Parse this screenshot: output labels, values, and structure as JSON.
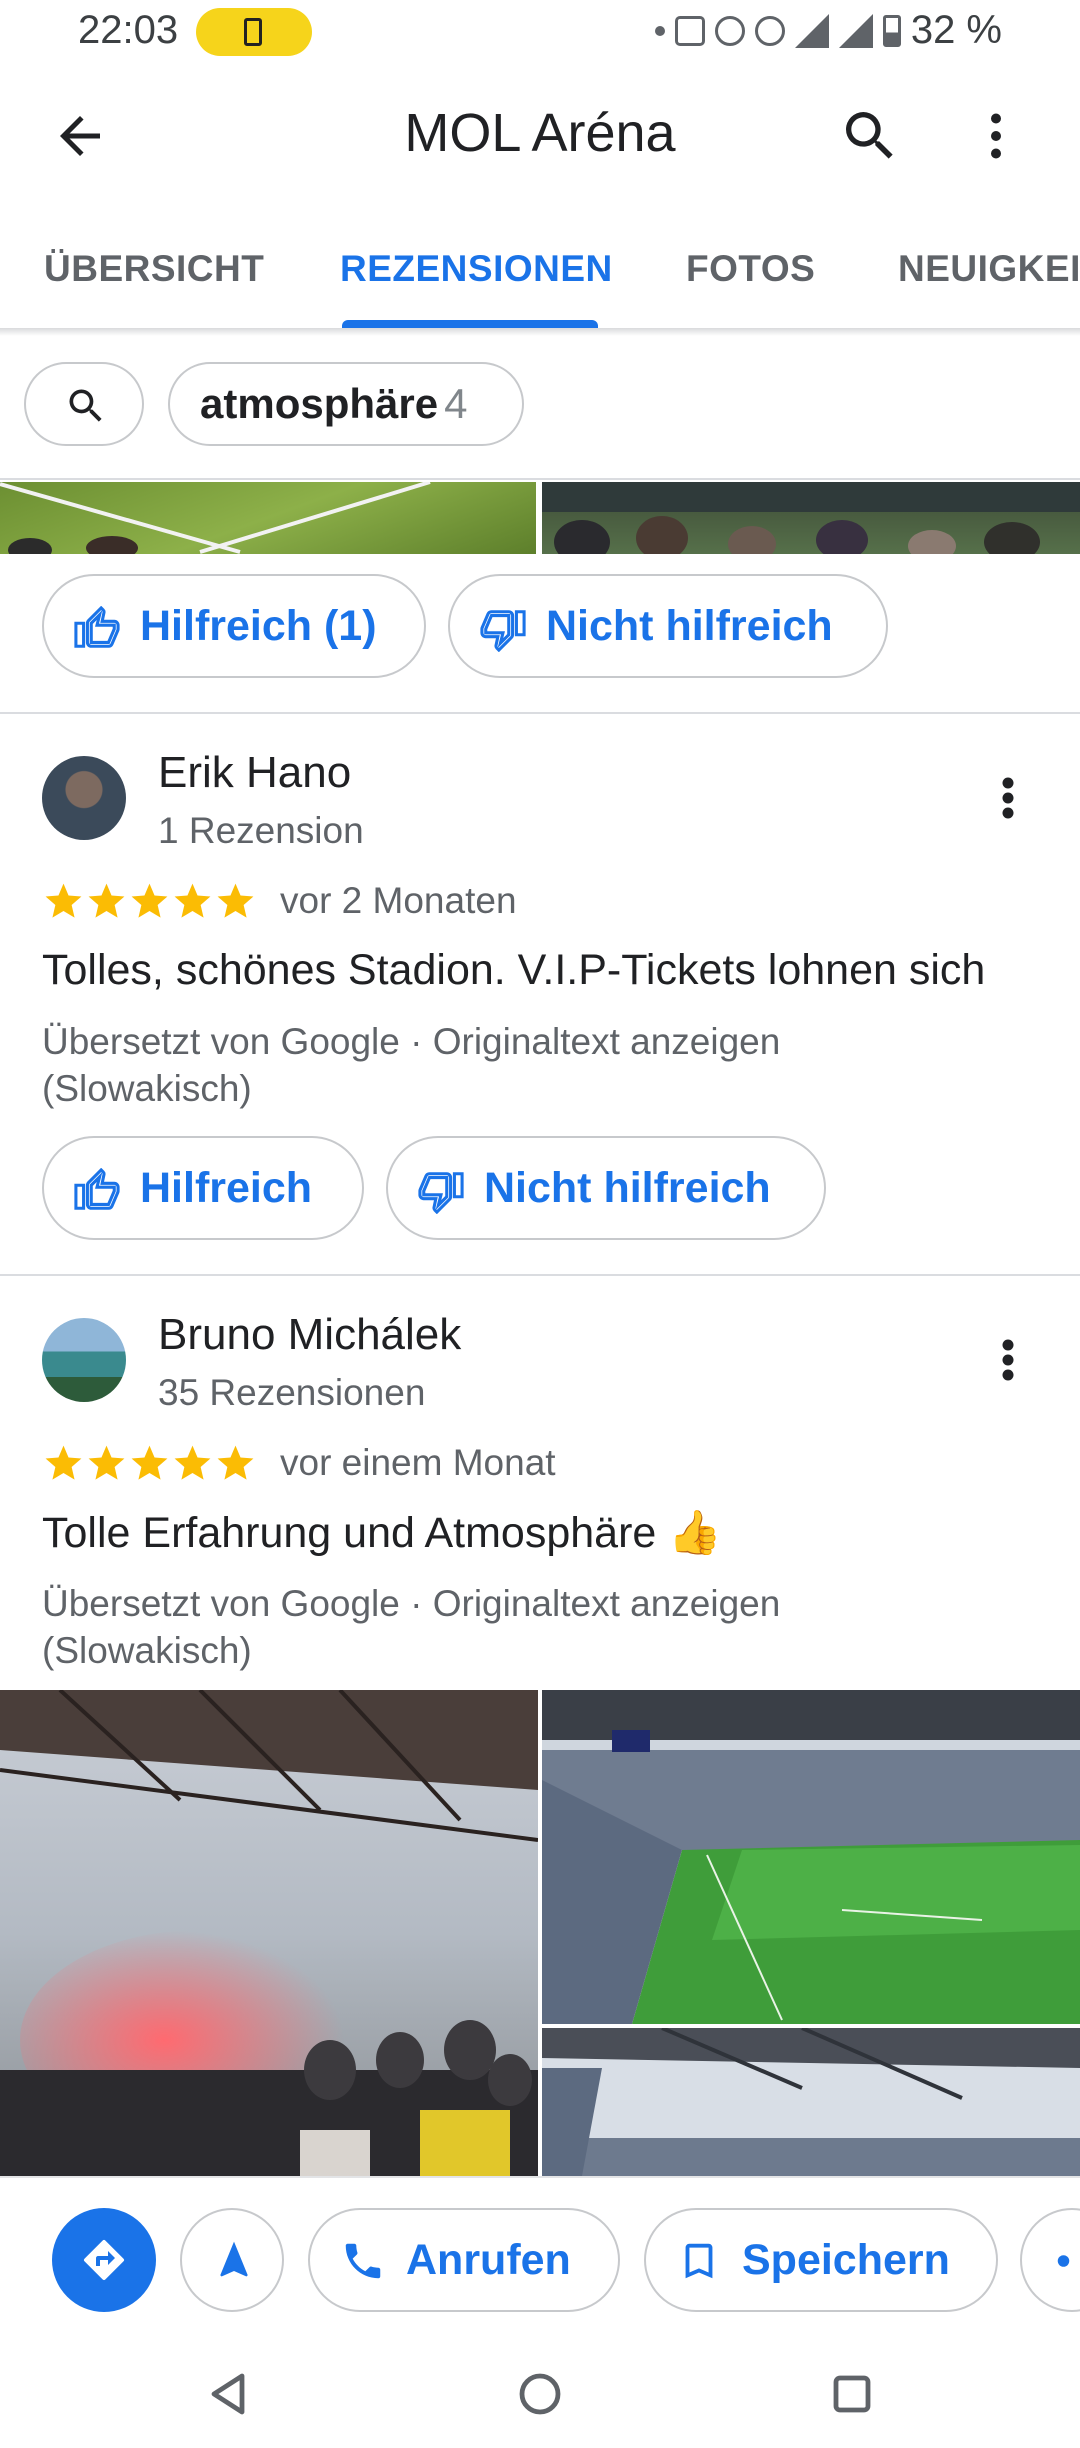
{
  "status_bar": {
    "time": "22:03",
    "battery_percent": "32 %",
    "icons": [
      "dot-icon",
      "60hz-icon",
      "location-icon",
      "wifi-icon",
      "signal-icon",
      "battery-icon"
    ]
  },
  "app_bar": {
    "title": "MOL Aréna",
    "icons": [
      "back-arrow-icon",
      "search-icon",
      "more-vert-icon"
    ]
  },
  "tabs": [
    {
      "label": "ÜBERSICHT",
      "active": false
    },
    {
      "label": "REZENSIONEN",
      "active": true
    },
    {
      "label": "FOTOS",
      "active": false
    },
    {
      "label": "NEUIGKEITEN",
      "active": false
    }
  ],
  "filter": {
    "keyword": "atmosphäre",
    "count": "4"
  },
  "previous_review": {
    "helpful_label": "Hilfreich (1)",
    "not_helpful_label": "Nicht hilfreich"
  },
  "reviews": [
    {
      "name": "Erik Hano",
      "meta": "1 Rezension",
      "rating": 5,
      "date": "vor 2 Monaten",
      "text": "Tolles, schönes Stadion. V.I.P-Tickets lohnen sich",
      "translated_by": "Übersetzt von Google · Originaltext anzeigen",
      "original_language": "(Slowakisch)",
      "helpful_label": "Hilfreich",
      "not_helpful_label": "Nicht hilfreich"
    },
    {
      "name": "Bruno Michálek",
      "meta": "35 Rezensionen",
      "rating": 5,
      "date": "vor einem Monat",
      "text": "Tolle Erfahrung und Atmosphäre 👍",
      "translated_by": "Übersetzt von Google · Originaltext anzeigen",
      "original_language": "(Slowakisch)"
    }
  ],
  "bottom_actions": {
    "call_label": "Anrufen",
    "save_label": "Speichern"
  },
  "colors": {
    "accent": "#1a73e8",
    "star": "#fbbc04",
    "text_secondary": "#5f6368"
  }
}
